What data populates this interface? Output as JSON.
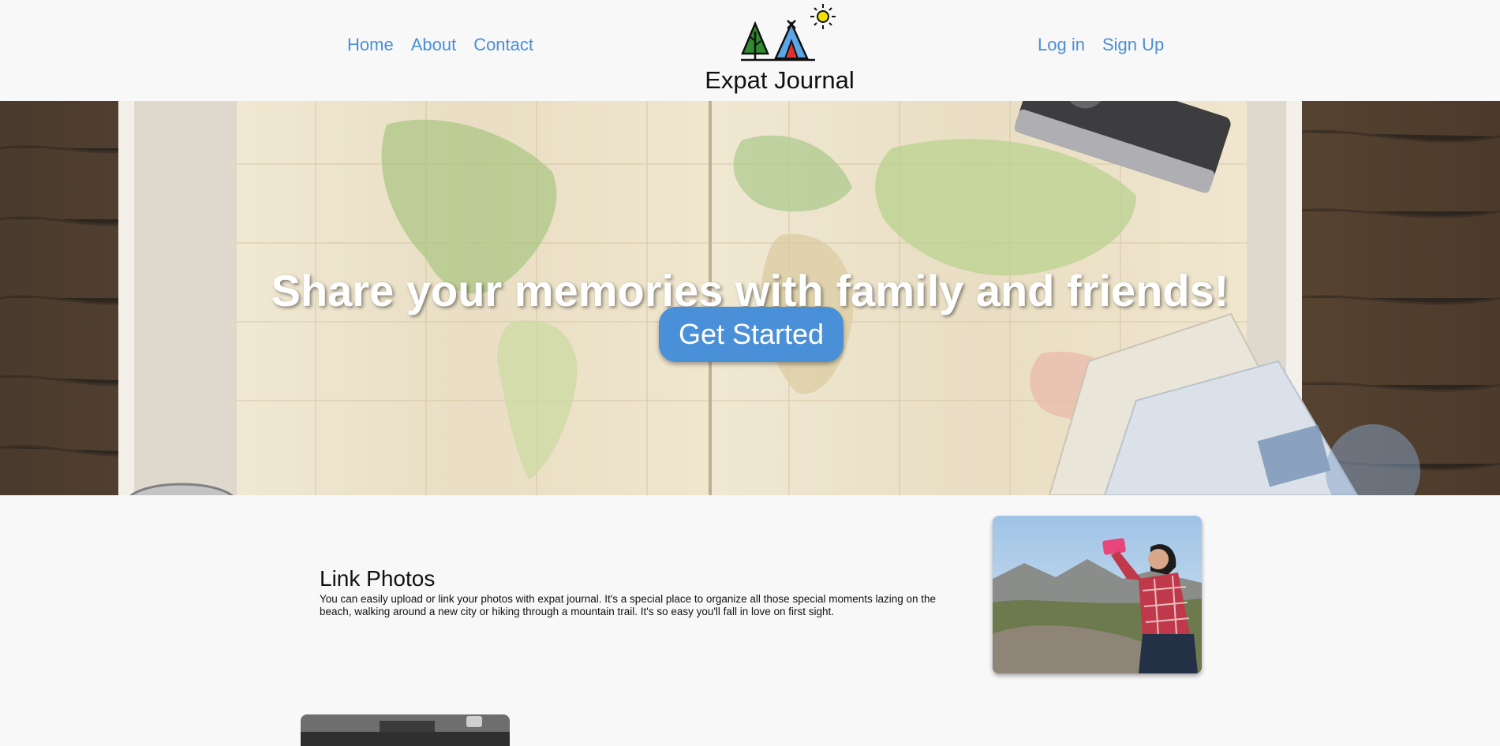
{
  "header": {
    "nav_left": [
      {
        "label": "Home"
      },
      {
        "label": "About"
      },
      {
        "label": "Contact"
      }
    ],
    "nav_right": [
      {
        "label": "Log in"
      },
      {
        "label": "Sign Up"
      }
    ],
    "brand": "Expat Journal",
    "logo_icons": [
      "tree-icon",
      "tent-icon",
      "sun-icon"
    ]
  },
  "hero": {
    "title": "Share your memories with family and friends!",
    "cta_label": "Get Started"
  },
  "feature": {
    "title": "Link Photos",
    "text": "You can easily upload or link your photos with expat journal. It's a special place to organize all those special moments lazing on the beach, walking around a new city or hiking through a mountain trail. It's so easy you'll fall in love on first sight."
  },
  "colors": {
    "accent": "#4a90d8",
    "link": "#4a8fd6",
    "background": "#f8f8f8"
  }
}
